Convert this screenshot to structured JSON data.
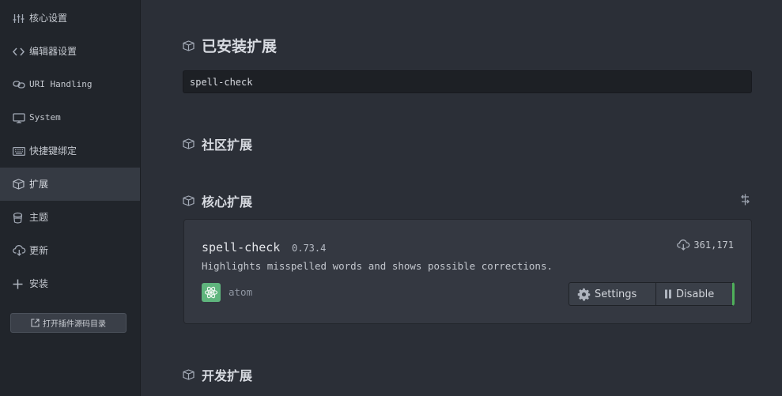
{
  "sidebar": {
    "items": [
      {
        "label": "核心设置",
        "icon": "sliders-icon"
      },
      {
        "label": "编辑器设置",
        "icon": "code-icon"
      },
      {
        "label": "URI Handling",
        "icon": "link-icon"
      },
      {
        "label": "System",
        "icon": "monitor-icon"
      },
      {
        "label": "快捷键绑定",
        "icon": "keyboard-icon"
      },
      {
        "label": "扩展",
        "icon": "package-icon"
      },
      {
        "label": "主题",
        "icon": "paintcan-icon"
      },
      {
        "label": "更新",
        "icon": "cloud-download-icon"
      },
      {
        "label": "安装",
        "icon": "plus-icon"
      }
    ],
    "active": "扩展",
    "open_folder_label": "打开插件源码目录"
  },
  "main": {
    "installed_title": "已安装扩展",
    "search_value": "spell-check",
    "community_title": "社区扩展",
    "core_title": "核心扩展",
    "dev_title": "开发扩展",
    "package": {
      "name": "spell-check",
      "version": "0.73.4",
      "description": "Highlights misspelled words and shows possible corrections.",
      "downloads": "361,171",
      "author": "atom",
      "settings_label": "Settings",
      "disable_label": "Disable",
      "enabled_color": "#4fb05a"
    }
  },
  "colors": {
    "background": "#2b2f37",
    "sidebar": "#21252b",
    "active_item": "#353a43",
    "card": "#343841"
  }
}
